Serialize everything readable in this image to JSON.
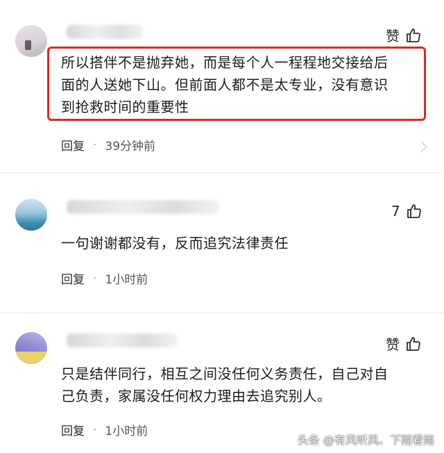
{
  "comments": [
    {
      "like_label": "赞",
      "text_lines": [
        "所以搭伴不是抛弃她，而是每个人一程程地交接给后",
        "面的人送她下山。但前面人都不是太专业，没有意识",
        "到抢救时间的重要性"
      ],
      "reply_label": "回复",
      "time": "39分钟前"
    },
    {
      "like_label": "7",
      "text_lines": [
        "一句谢谢都没有，反而追究法律责任"
      ],
      "reply_label": "回复",
      "time": "1小时前"
    },
    {
      "like_label": "赞",
      "text_lines": [
        "只是结伴同行，相互之间没任何义务责任，自己对自",
        "己负责，家属没任何权力理由去追究别人。"
      ],
      "reply_label": "回复",
      "time": "1小时前"
    }
  ],
  "meta_separator": "·",
  "watermark": "头条 @有风听风、下雨看雨",
  "colors": {
    "highlight": "#e0261e",
    "background": "#ffffff"
  },
  "icons": [
    "thumbs-up-icon"
  ]
}
